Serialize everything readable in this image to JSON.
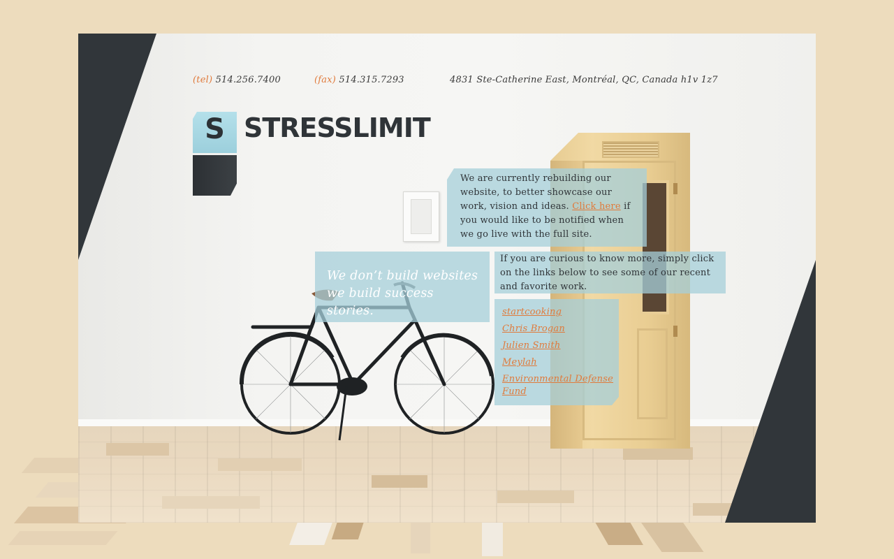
{
  "contact": {
    "tel_label": "(tel)",
    "tel": "514.256.7400",
    "fax_label": "(fax)",
    "fax": "514.315.7293",
    "address": "4831 Ste-Catherine East, Montréal, QC, Canada h1v 1z7"
  },
  "logo": {
    "mark": "S",
    "wordmark": "STRESSLIMIT"
  },
  "intro": {
    "text_before": "We are currently rebuilding our website, to better showcase our work, vision and ideas. ",
    "link": "Click here",
    "text_after": " if you would like to be notified when we go live with the full site."
  },
  "tagline": {
    "line1": "We don’t build websites",
    "line2": "we build success stories."
  },
  "curious": {
    "text": "If you are curious to know more, simply click on the links below to see some of our recent and favorite work."
  },
  "work_links": [
    {
      "label": "startcooking"
    },
    {
      "label": "Chris Brogan"
    },
    {
      "label": "Julien Smith"
    },
    {
      "label": "Meylah"
    },
    {
      "label": "Environmental Defense Fund"
    }
  ],
  "colors": {
    "background": "#eddcbd",
    "dark": "#31363a",
    "accent": "#e07a3b",
    "box": "#a5cfda"
  }
}
